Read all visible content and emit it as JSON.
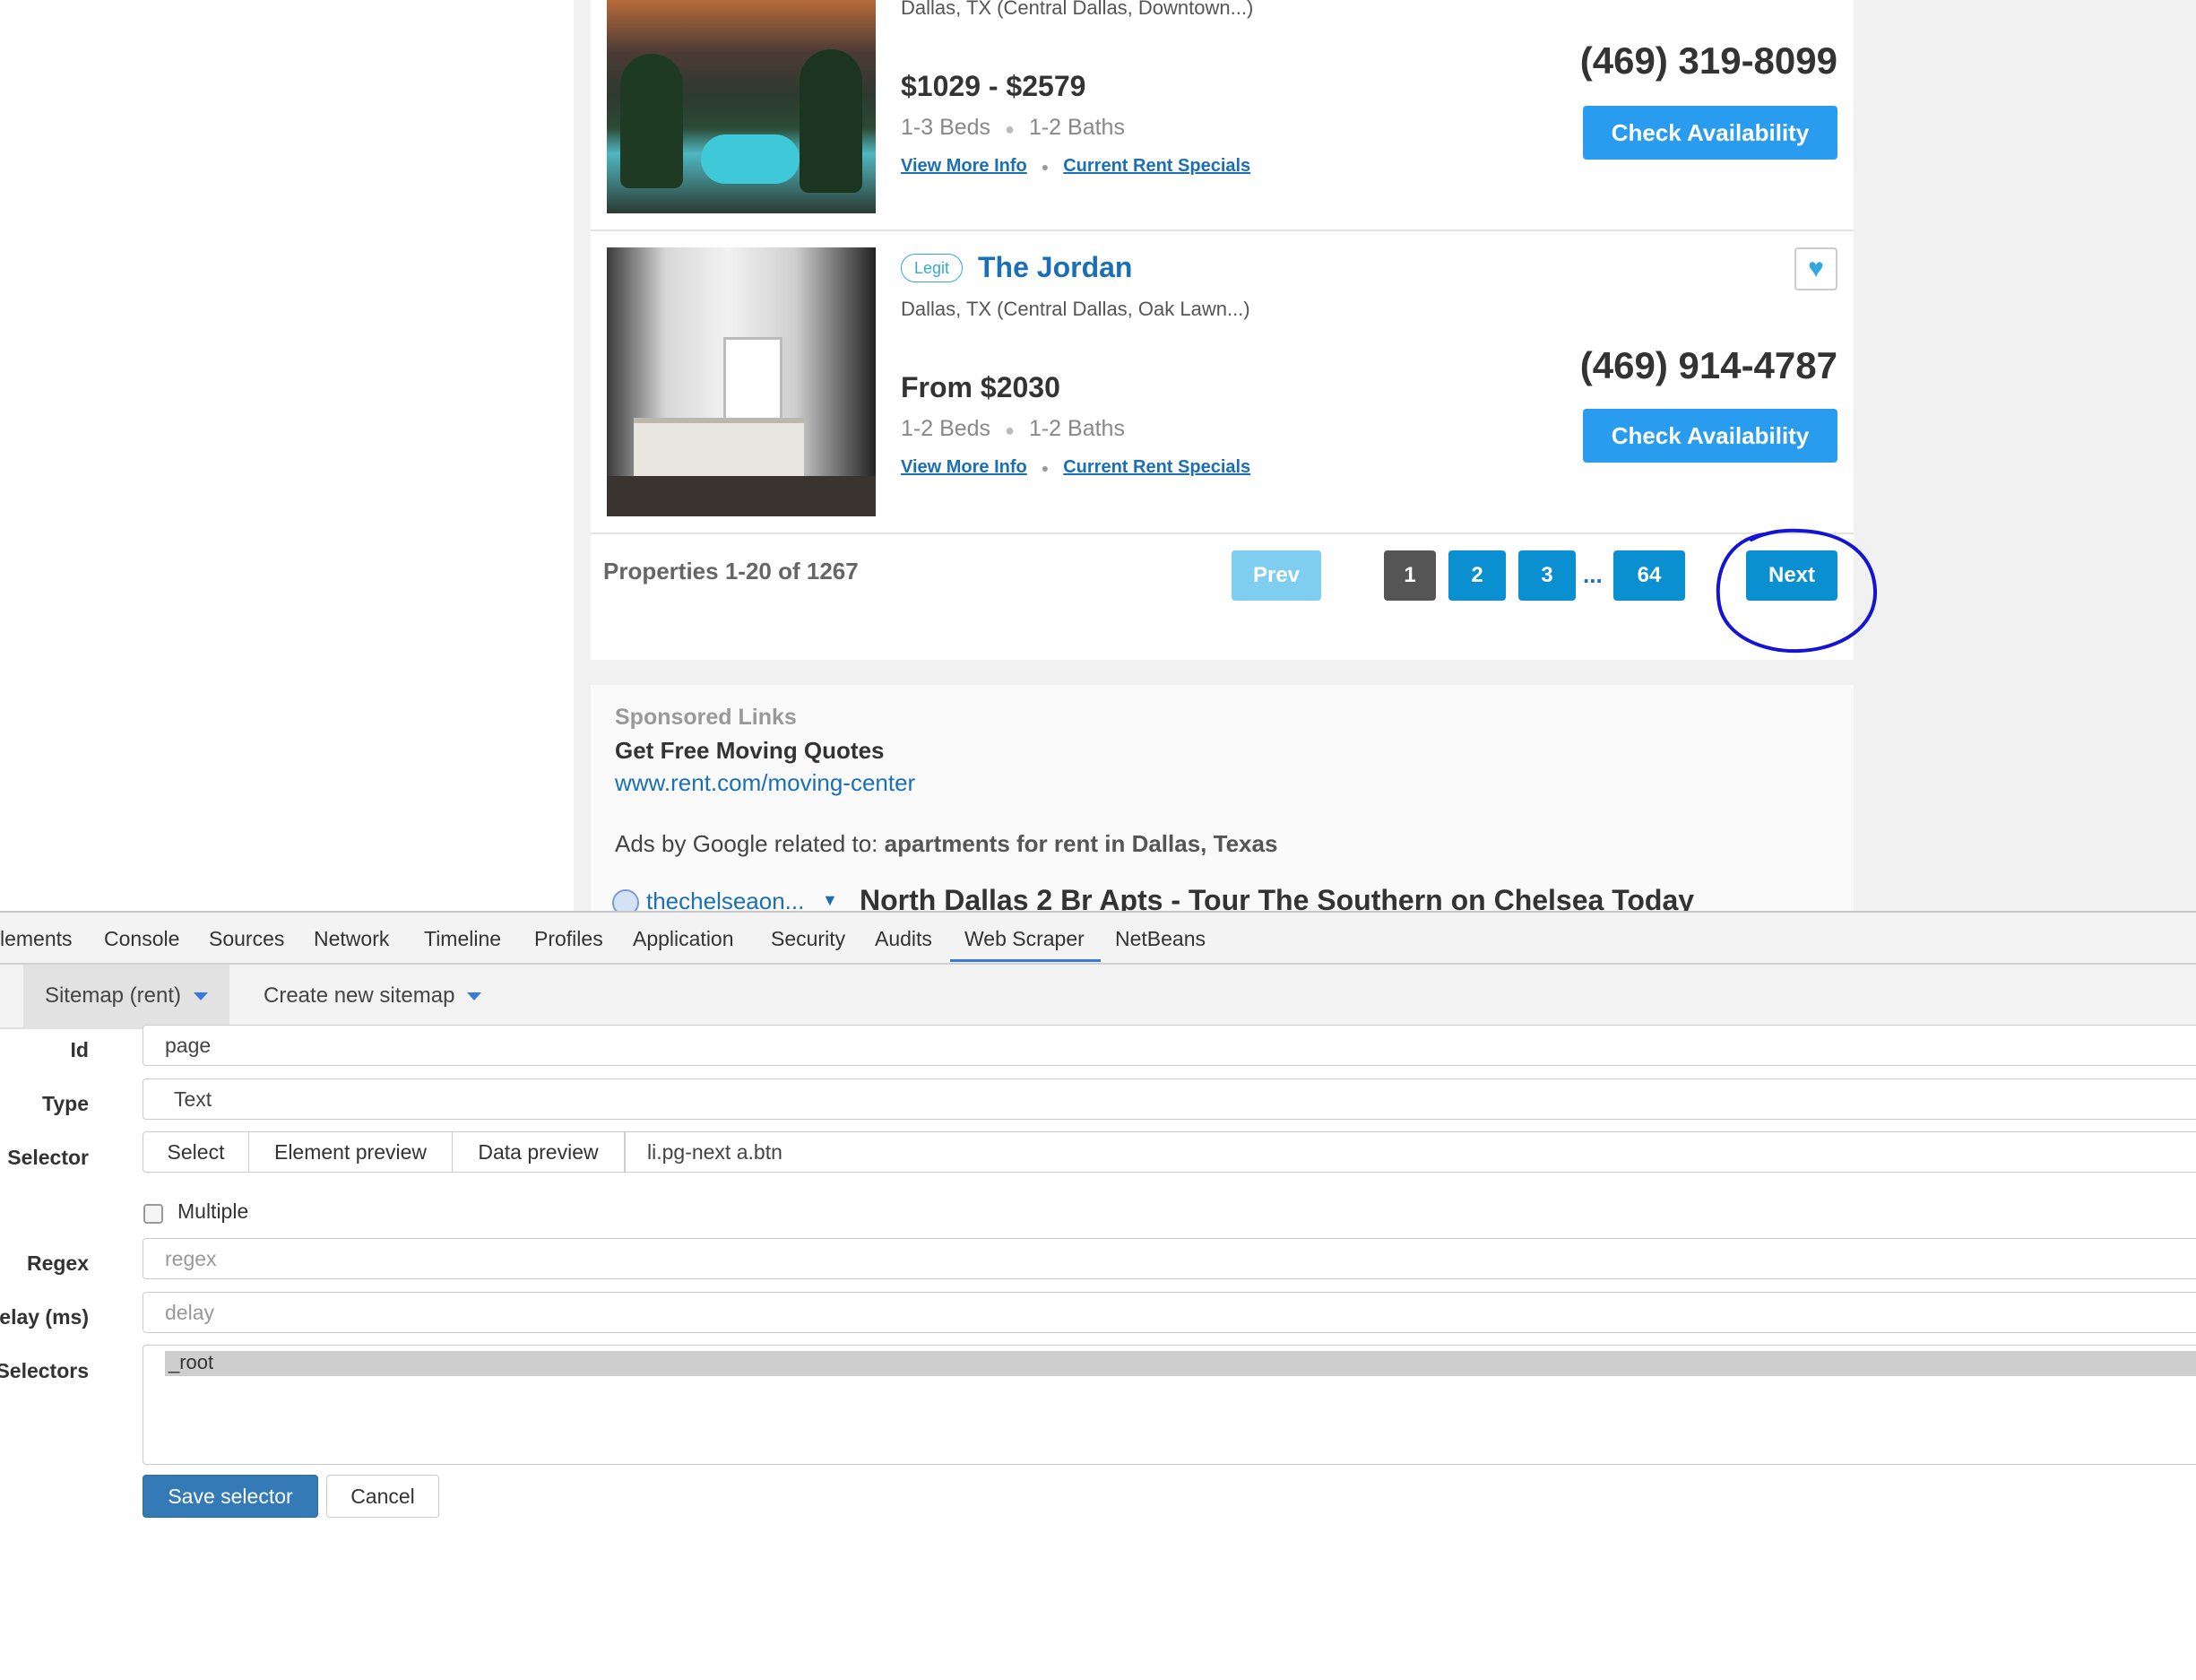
{
  "listings": [
    {
      "address": "Dallas, TX (Central Dallas, Downtown...)",
      "price": "$1029 - $2579",
      "beds": "1-3 Beds",
      "baths": "1-2 Baths",
      "more_info": "View More Info",
      "specials": "Current Rent Specials",
      "phone": "(469) 319-8099",
      "cta": "Check Availability"
    },
    {
      "badge": "Legit",
      "name": "The Jordan",
      "address": "Dallas, TX (Central Dallas, Oak Lawn...)",
      "price": "From $2030",
      "beds": "1-2 Beds",
      "baths": "1-2 Baths",
      "more_info": "View More Info",
      "specials": "Current Rent Specials",
      "phone": "(469) 914-4787",
      "cta": "Check Availability"
    }
  ],
  "pagination": {
    "count": "Properties 1-20 of 1267",
    "prev": "Prev",
    "pages": [
      "1",
      "2",
      "3",
      "64"
    ],
    "ellipsis": "...",
    "next": "Next",
    "current": "1",
    "annotation_color": "#1414d2"
  },
  "sponsored": {
    "heading": "Sponsored Links",
    "title": "Get Free Moving Quotes",
    "url": "www.rent.com/moving-center",
    "ads_prefix": "Ads by Google related to:",
    "ads_query": "apartments for rent in Dallas, Texas",
    "domain": "thechelseaon...",
    "caret": "▼",
    "headline": "North Dallas 2 Br Apts - Tour The Southern on Chelsea Today"
  },
  "devtools": {
    "tabs": [
      "lements",
      "Console",
      "Sources",
      "Network",
      "Timeline",
      "Profiles",
      "Application",
      "Security",
      "Audits",
      "Web Scraper",
      "NetBeans"
    ],
    "active_tab": "Web Scraper",
    "sitemap_menu": "Sitemap (rent)",
    "create_menu": "Create new sitemap",
    "form": {
      "id_label": "Id",
      "id_value": "page",
      "type_label": "Type",
      "type_value": "Text",
      "selector_label": "Selector",
      "select_btn": "Select",
      "element_preview_btn": "Element preview",
      "data_preview_btn": "Data preview",
      "selector_value": "li.pg-next a.btn",
      "multiple_label": "Multiple",
      "multiple_checked": false,
      "regex_label": "Regex",
      "regex_placeholder": "regex",
      "delay_label": "elay (ms)",
      "delay_placeholder": "delay",
      "parents_label": "Selectors",
      "parents_option": "_root",
      "save_btn": "Save selector",
      "cancel_btn": "Cancel"
    },
    "accent_color": "#3879d9"
  }
}
